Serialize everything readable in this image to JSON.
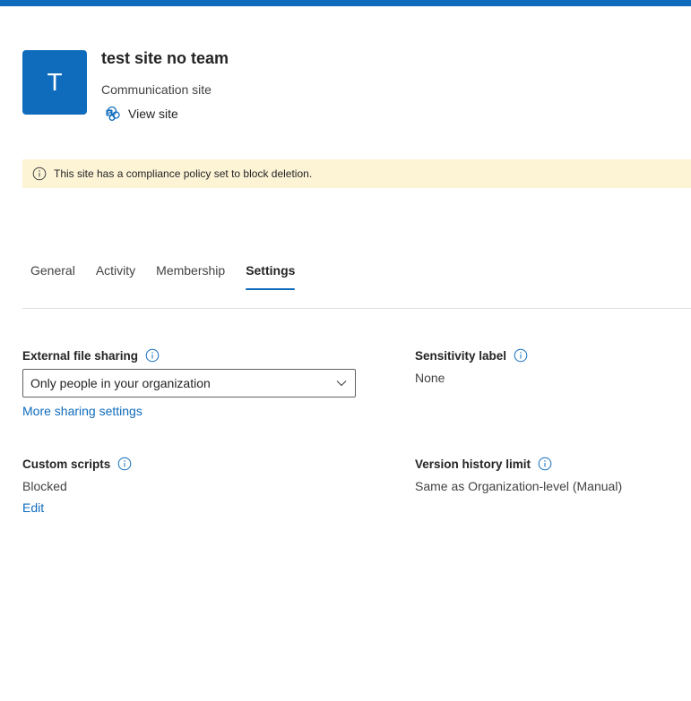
{
  "header": {
    "avatar_letter": "T",
    "site_title": "test site no team",
    "site_type": "Communication site",
    "view_site_label": "View site"
  },
  "banner": {
    "text": "This site has a compliance policy set to block deletion."
  },
  "tabs": [
    {
      "label": "General",
      "active": false
    },
    {
      "label": "Activity",
      "active": false
    },
    {
      "label": "Membership",
      "active": false
    },
    {
      "label": "Settings",
      "active": true
    }
  ],
  "settings": {
    "external_sharing": {
      "label": "External file sharing",
      "selected": "Only people in your organization",
      "more_link": "More sharing settings"
    },
    "sensitivity": {
      "label": "Sensitivity label",
      "value": "None"
    },
    "custom_scripts": {
      "label": "Custom scripts",
      "value": "Blocked",
      "edit_link": "Edit"
    },
    "version_history": {
      "label": "Version history limit",
      "value": "Same as Organization-level (Manual)"
    }
  },
  "colors": {
    "accent": "#0f6cbd",
    "banner_bg": "#fdf4d6"
  }
}
